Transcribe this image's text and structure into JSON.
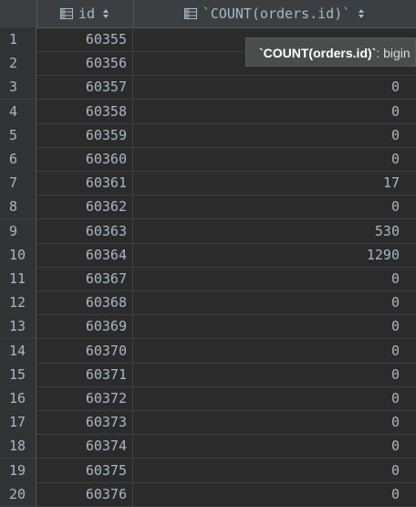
{
  "header": {
    "col_id": "id",
    "col_count": "`COUNT(orders.id)`",
    "sort_icon": "sort-updown-icon",
    "table_icon": "table-column-icon"
  },
  "rows": [
    {
      "num": "1",
      "id": "60355",
      "count": ""
    },
    {
      "num": "2",
      "id": "60356",
      "count": ""
    },
    {
      "num": "3",
      "id": "60357",
      "count": "0"
    },
    {
      "num": "4",
      "id": "60358",
      "count": "0"
    },
    {
      "num": "5",
      "id": "60359",
      "count": "0"
    },
    {
      "num": "6",
      "id": "60360",
      "count": "0"
    },
    {
      "num": "7",
      "id": "60361",
      "count": "17"
    },
    {
      "num": "8",
      "id": "60362",
      "count": "0"
    },
    {
      "num": "9",
      "id": "60363",
      "count": "530"
    },
    {
      "num": "10",
      "id": "60364",
      "count": "1290"
    },
    {
      "num": "11",
      "id": "60367",
      "count": "0"
    },
    {
      "num": "12",
      "id": "60368",
      "count": "0"
    },
    {
      "num": "13",
      "id": "60369",
      "count": "0"
    },
    {
      "num": "14",
      "id": "60370",
      "count": "0"
    },
    {
      "num": "15",
      "id": "60371",
      "count": "0"
    },
    {
      "num": "16",
      "id": "60372",
      "count": "0"
    },
    {
      "num": "17",
      "id": "60373",
      "count": "0"
    },
    {
      "num": "18",
      "id": "60374",
      "count": "0"
    },
    {
      "num": "19",
      "id": "60375",
      "count": "0"
    },
    {
      "num": "20",
      "id": "60376",
      "count": "0"
    }
  ],
  "tooltip": {
    "name": "`COUNT(orders.id)`",
    "type": ": bigin"
  },
  "colors": {
    "background": "#2b2b2b",
    "header": "#3c3f41",
    "text": "#a9b7c6"
  }
}
